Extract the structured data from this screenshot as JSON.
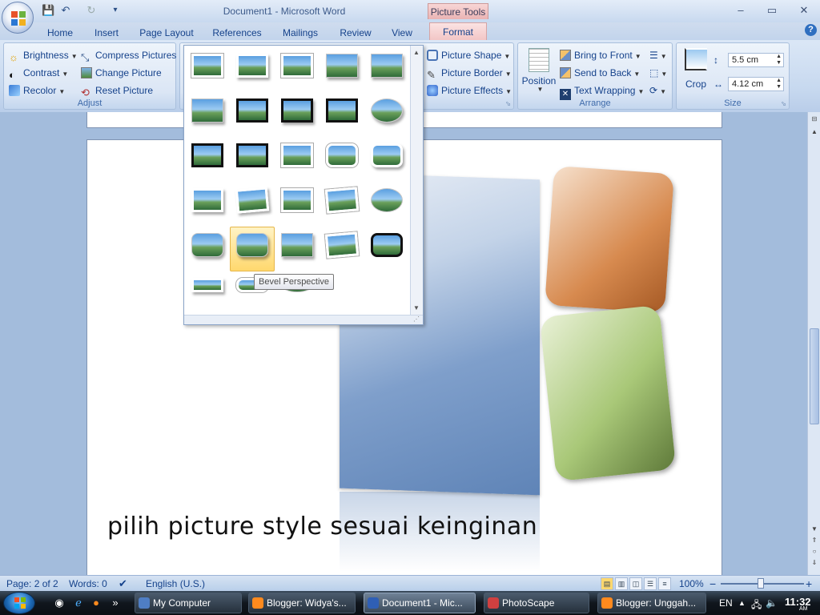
{
  "window": {
    "title": "Document1 - Microsoft Word",
    "context_tab_label": "Picture Tools",
    "minimize": "–",
    "maximize": "▭",
    "close": "✕"
  },
  "quick_access": {
    "save": "💾",
    "undo": "↶",
    "redo": "↻",
    "more": "▾"
  },
  "tabs": [
    "Home",
    "Insert",
    "Page Layout",
    "References",
    "Mailings",
    "Review",
    "View"
  ],
  "active_tab": "Format",
  "help": "?",
  "ribbon": {
    "adjust": {
      "label": "Adjust",
      "brightness": "Brightness",
      "contrast": "Contrast",
      "recolor": "Recolor",
      "compress": "Compress Pictures",
      "change": "Change Picture",
      "reset": "Reset Picture"
    },
    "styles": {
      "picture_shape": "Picture Shape",
      "picture_border": "Picture Border",
      "picture_effects": "Picture Effects"
    },
    "arrange": {
      "label": "Arrange",
      "position": "Position",
      "bring_front": "Bring to Front",
      "send_back": "Send to Back",
      "text_wrapping": "Text Wrapping"
    },
    "size": {
      "label": "Size",
      "crop": "Crop",
      "height": "5.5 cm",
      "width": "4.12 cm"
    }
  },
  "gallery": {
    "tooltip": "Bevel Perspective",
    "hovered_index": 21
  },
  "document": {
    "caption": "pilih picture style sesuai keinginan"
  },
  "statusbar": {
    "page": "Page: 2 of 2",
    "words": "Words: 0",
    "language": "English (U.S.)",
    "zoom": "100%",
    "zoom_minus": "−",
    "zoom_plus": "+"
  },
  "taskbar": {
    "items": [
      {
        "label": "My Computer",
        "active": false
      },
      {
        "label": "Blogger: Widya's...",
        "active": false
      },
      {
        "label": "Document1 - Mic...",
        "active": true
      },
      {
        "label": "PhotoScape",
        "active": false
      },
      {
        "label": "Blogger: Unggah...",
        "active": false
      }
    ],
    "more": "»",
    "lang": "EN",
    "time": "11:32",
    "ampm": "AM"
  },
  "colors": {
    "ribbon_bg": "#c6d8ef",
    "context_tab": "#f2c6c6",
    "text_blue": "#15428b",
    "hover_gold": "#ffd86e"
  }
}
